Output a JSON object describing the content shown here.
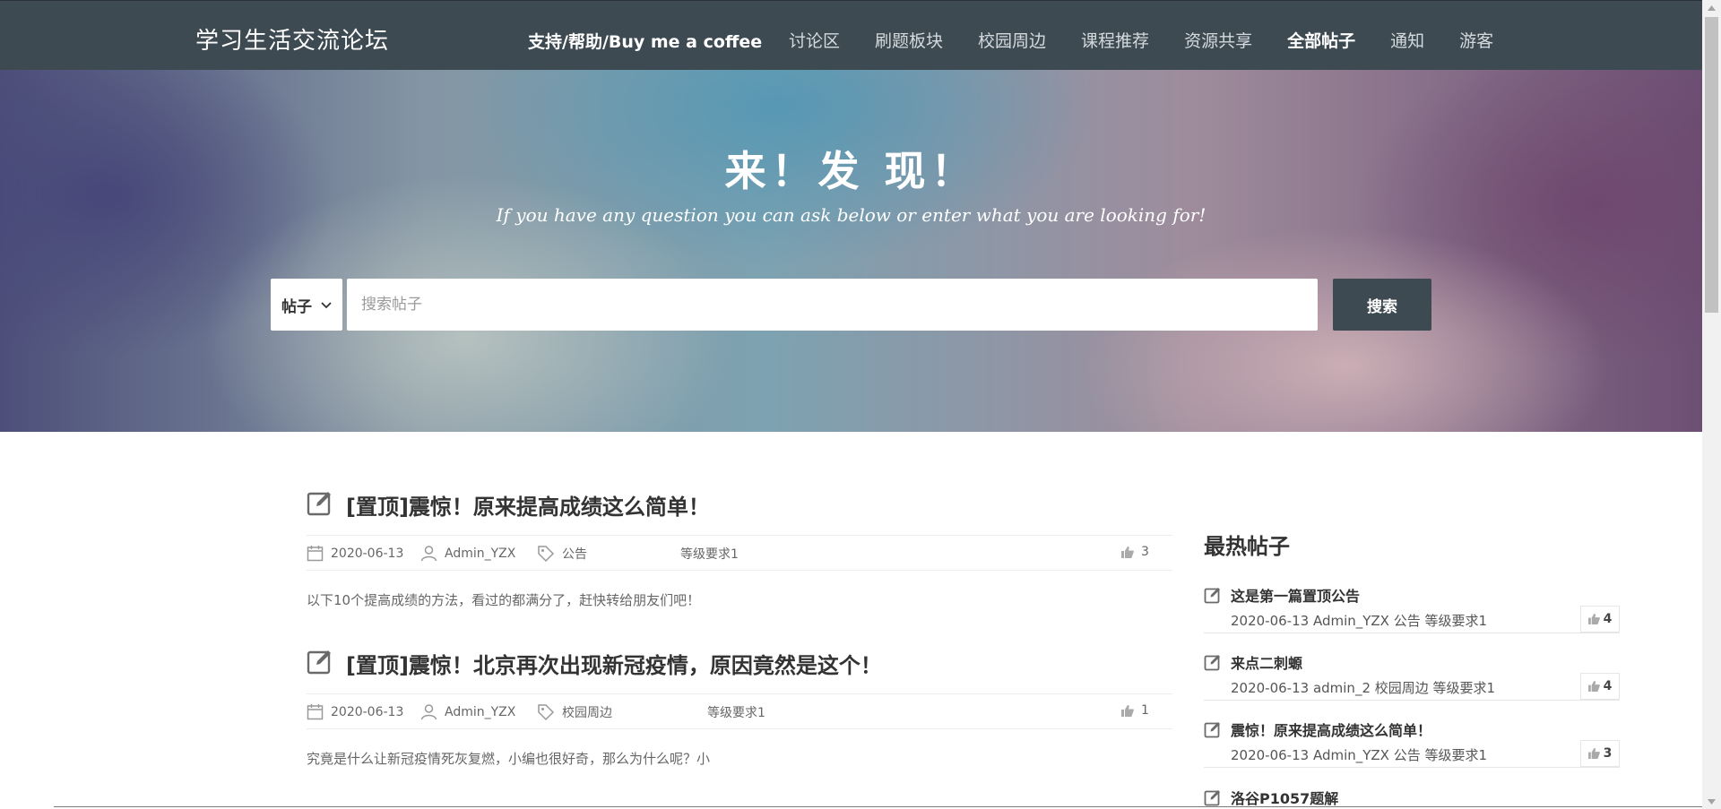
{
  "header": {
    "brand": "学习生活交流论坛",
    "support_link": "支持/帮助/Buy me a coffee",
    "nav": [
      {
        "label": "讨论区",
        "active": false
      },
      {
        "label": "刷题板块",
        "active": false
      },
      {
        "label": "校园周边",
        "active": false
      },
      {
        "label": "课程推荐",
        "active": false
      },
      {
        "label": "资源共享",
        "active": false
      },
      {
        "label": "全部帖子",
        "active": true
      },
      {
        "label": "通知",
        "active": false
      },
      {
        "label": "游客",
        "active": false
      }
    ]
  },
  "hero": {
    "title": "来！发 现！",
    "subtitle": "If you have any question you can ask below or enter what you are looking for!",
    "search": {
      "scope_selected": "帖子",
      "placeholder": "搜索帖子",
      "value": "",
      "button_label": "搜索"
    }
  },
  "posts": [
    {
      "title": "[置顶]震惊！原来提高成绩这么简单！",
      "date": "2020-06-13",
      "author": "Admin_YZX",
      "tag": "公告",
      "level": "等级要求1",
      "likes": "3",
      "excerpt": "以下10个提高成绩的方法，看过的都满分了，赶快转给朋友们吧！"
    },
    {
      "title": "[置顶]震惊！北京再次出现新冠疫情，原因竟然是这个！",
      "date": "2020-06-13",
      "author": "Admin_YZX",
      "tag": "校园周边",
      "level": "等级要求1",
      "likes": "1",
      "excerpt": "究竟是什么让新冠疫情死灰复燃，小编也很好奇，那么为什么呢？小"
    }
  ],
  "sidebar": {
    "title": "最热帖子",
    "items": [
      {
        "title": "这是第一篇置顶公告",
        "meta": "2020-06-13 Admin_YZX 公告 等级要求1",
        "likes": "4"
      },
      {
        "title": "来点二刺螈",
        "meta": "2020-06-13 admin_2 校园周边 等级要求1",
        "likes": "4"
      },
      {
        "title": "震惊！原来提高成绩这么简单！",
        "meta": "2020-06-13 Admin_YZX 公告 等级要求1",
        "likes": "3"
      },
      {
        "title": "洛谷P1057题解",
        "meta": "",
        "likes": ""
      }
    ]
  },
  "colors": {
    "topbar": "#3e4a52",
    "search_button": "#3e4a52",
    "text": "#333333",
    "muted": "#666666"
  },
  "icons": {
    "post": "edit-square-icon",
    "date": "calendar-icon",
    "author": "user-icon",
    "tag": "tag-icon",
    "like": "thumbs-up-icon",
    "select": "chevron-down-icon"
  }
}
